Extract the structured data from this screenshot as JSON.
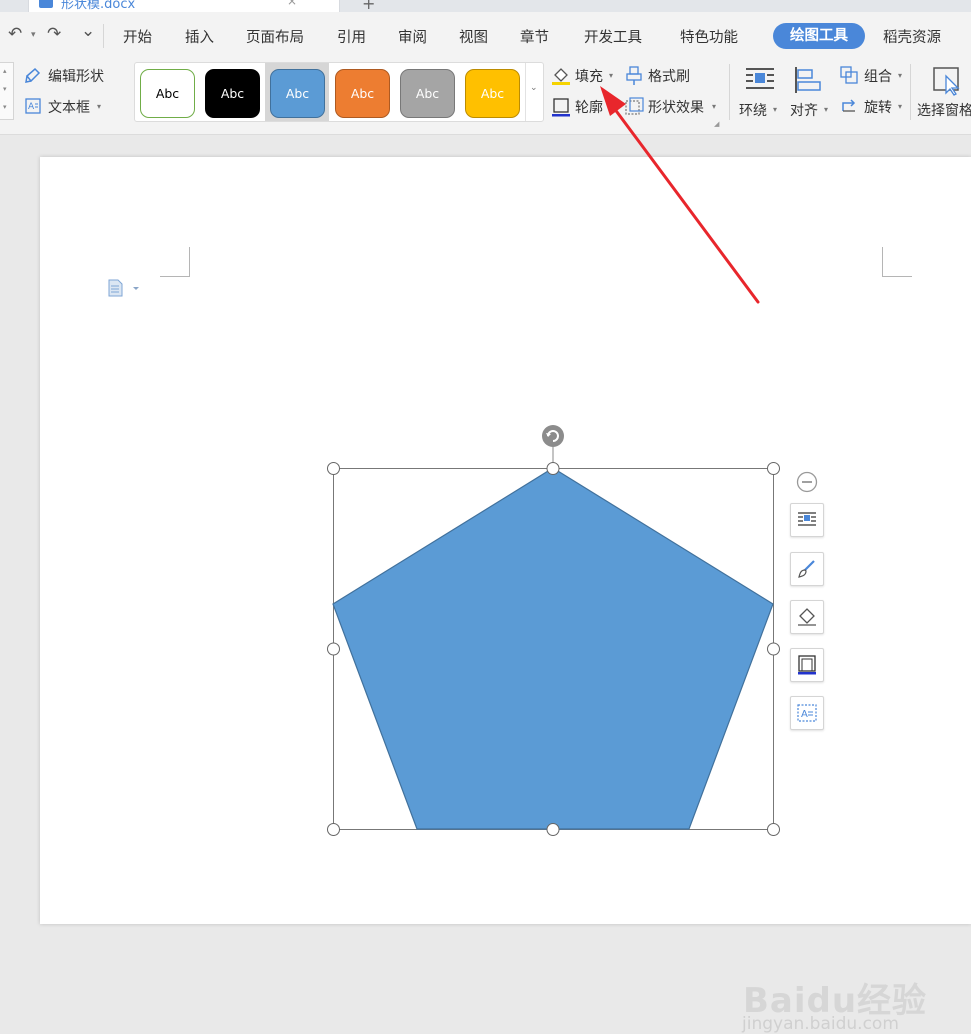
{
  "document_tab": {
    "title": "形状模.docx",
    "close": "×",
    "new_tab": "+"
  },
  "quick_access": {
    "undo": "↶",
    "undo_caret": "▾",
    "redo": "↷",
    "more": "⌄"
  },
  "menu_tabs": [
    "开始",
    "插入",
    "页面布局",
    "引用",
    "审阅",
    "视图",
    "章节",
    "开发工具",
    "特色功能",
    "绘图工具",
    "稻壳资源"
  ],
  "active_tab": "绘图工具",
  "ribbon": {
    "edit_shape": "编辑形状",
    "text_box": "文本框",
    "style_swatches": [
      {
        "label": "Abc",
        "fill": "#ffffff",
        "border": "#70ad47",
        "text": "#000000"
      },
      {
        "label": "Abc",
        "fill": "#000000",
        "border": "#000000",
        "text": "#ffffff"
      },
      {
        "label": "Abc",
        "fill": "#5b9bd5",
        "border": "#41719c",
        "text": "#ffffff"
      },
      {
        "label": "Abc",
        "fill": "#ed7d31",
        "border": "#ae5a21",
        "text": "#ffffff"
      },
      {
        "label": "Abc",
        "fill": "#a5a5a5",
        "border": "#787878",
        "text": "#ffffff"
      },
      {
        "label": "Abc",
        "fill": "#ffc000",
        "border": "#bc8c00",
        "text": "#ffffff"
      }
    ],
    "fill": "填充",
    "format_painter": "格式刷",
    "outline": "轮廓",
    "shape_effects": "形状效果",
    "wrap": "环绕",
    "align": "对齐",
    "group": "组合",
    "rotate": "旋转",
    "selection_pane": "选择窗格"
  },
  "shape": {
    "type": "pentagon",
    "fill": "#5b9bd5",
    "stroke": "#41719c"
  },
  "floating_toolbar": [
    "collapse-icon",
    "wrap-layout-icon",
    "brush-icon",
    "fill-bucket-icon",
    "outline-icon",
    "textbox-icon"
  ],
  "annotation": {
    "color": "#e8262c",
    "points_to": "填充"
  },
  "watermark": {
    "main": "Baidu经验",
    "sub": "jingyan.baidu.com"
  },
  "colors": {
    "accent": "#4a87d9",
    "ribbon_bg": "#f3f3f3",
    "canvas_bg": "#e9e9e9"
  }
}
